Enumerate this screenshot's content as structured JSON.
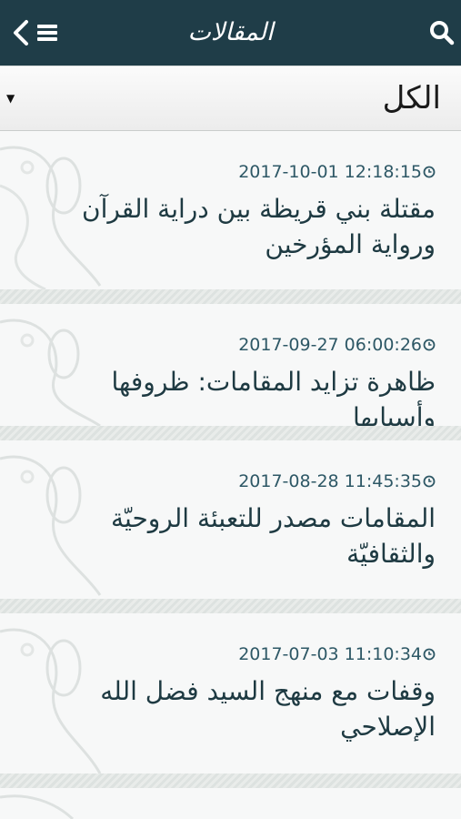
{
  "header": {
    "title": "المقالات"
  },
  "filter": {
    "selected": "الكل"
  },
  "articles": [
    {
      "datetime": "2017-10-01 12:18:15",
      "title": "مقتلة بني قريظة بين دراية القرآن ورواية المؤرخين"
    },
    {
      "datetime": "2017-09-27 06:00:26",
      "title": "ظاهرة تزايد المقامات: ظروفها وأسبابها"
    },
    {
      "datetime": "2017-08-28 11:45:35",
      "title": "المقامات مصدر للتعبئة الروحيّة والثقافيّة"
    },
    {
      "datetime": "2017-07-03 11:10:34",
      "title": "وقفات مع منهج السيد فضل الله الإصلاحي"
    }
  ]
}
